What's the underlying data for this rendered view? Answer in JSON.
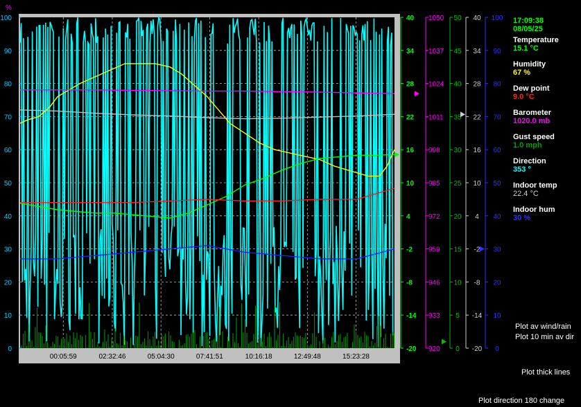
{
  "chart_data": {
    "type": "line",
    "x_ticks": [
      "00:05:59",
      "02:32:46",
      "05:04:30",
      "07:41:51",
      "10:16:18",
      "12:49:48",
      "15:23:28"
    ],
    "left_axis": {
      "label": "%",
      "ylim": [
        0,
        100
      ],
      "ticks": [
        "0",
        "10",
        "20",
        "30",
        "40",
        "50",
        "60",
        "70",
        "80",
        "90",
        "100"
      ]
    },
    "temp_axis": {
      "ylim": [
        -20,
        40
      ],
      "ticks": [
        "-20",
        "-14",
        "-8",
        "-2",
        "4",
        "10",
        "16",
        "22",
        "28",
        "34",
        "40"
      ]
    },
    "pressure_axis": {
      "ylim": [
        920,
        1050
      ],
      "ticks": [
        "920",
        "933",
        "946",
        "959",
        "972",
        "985",
        "998",
        "1011",
        "1024",
        "1037",
        "1050"
      ]
    },
    "wind_axis": {
      "ylim": [
        0,
        50
      ],
      "ticks": [
        "0",
        "5",
        "10",
        "15",
        "20",
        "25",
        "30",
        "35",
        "40",
        "45",
        "50"
      ]
    },
    "indoor_temp_axis": {
      "ylim": [
        -20,
        40
      ],
      "ticks": [
        "-20",
        "-14",
        "-8",
        "-2",
        "4",
        "10",
        "16",
        "22",
        "28",
        "34",
        "40"
      ]
    },
    "indoor_hum_axis": {
      "ylim": [
        0,
        100
      ],
      "ticks": [
        "0",
        "10",
        "20",
        "30",
        "40",
        "50",
        "60",
        "70",
        "80",
        "90",
        "100"
      ]
    },
    "series": [
      {
        "name": "Humidity",
        "color": "#ffff00",
        "x": [
          0,
          0.02,
          0.05,
          0.08,
          0.1,
          0.13,
          0.16,
          0.2,
          0.24,
          0.28,
          0.32,
          0.36,
          0.4,
          0.43,
          0.46,
          0.5,
          0.53,
          0.56,
          0.6,
          0.64,
          0.68,
          0.72,
          0.76,
          0.8,
          0.84,
          0.87,
          0.9,
          0.93,
          0.96,
          0.98,
          1
        ],
        "y": [
          68,
          69,
          70,
          73,
          76,
          78,
          80,
          82,
          84,
          86,
          86,
          86,
          85,
          83,
          80,
          76,
          72,
          68,
          65,
          62,
          60,
          59,
          58,
          57,
          55,
          54,
          53,
          52,
          52,
          55,
          60
        ]
      },
      {
        "name": "Temperature",
        "color": "#00ff00",
        "x": [
          0,
          0.05,
          0.1,
          0.15,
          0.2,
          0.25,
          0.3,
          0.35,
          0.4,
          0.45,
          0.5,
          0.55,
          0.6,
          0.65,
          0.7,
          0.75,
          0.8,
          0.85,
          0.9,
          0.95,
          1
        ],
        "y": [
          6.3,
          5.7,
          5.1,
          4.8,
          4.5,
          4.5,
          4.2,
          3.9,
          3.6,
          4.5,
          6,
          7.5,
          9.6,
          10.8,
          12.3,
          13.5,
          14.4,
          14.7,
          15,
          15,
          15.1
        ]
      },
      {
        "name": "Dew point",
        "color": "#ff2020",
        "x": [
          0,
          0.1,
          0.2,
          0.3,
          0.4,
          0.5,
          0.6,
          0.7,
          0.8,
          0.9,
          1
        ],
        "y": [
          6.4,
          6.4,
          6.4,
          6.4,
          6.7,
          7,
          6.7,
          6.7,
          7,
          7,
          9
        ]
      },
      {
        "name": "Barometer",
        "color": "#ff00ff",
        "x": [
          0,
          0.1,
          0.2,
          0.3,
          0.4,
          0.5,
          0.6,
          0.7,
          0.8,
          0.9,
          1
        ],
        "y": [
          1021.5,
          1021.5,
          1021.5,
          1021.3,
          1021.2,
          1021,
          1021,
          1020.8,
          1020.6,
          1020.3,
          1020
        ]
      },
      {
        "name": "Indoor temp",
        "color": "#c0c0c0",
        "x": [
          0,
          0.1,
          0.2,
          0.3,
          0.4,
          0.5,
          0.6,
          0.7,
          0.8,
          0.9,
          1
        ],
        "y": [
          23.2,
          23,
          22.6,
          22.3,
          22.1,
          21.8,
          21.6,
          21.7,
          21.9,
          22.1,
          22.4
        ]
      },
      {
        "name": "Indoor hum",
        "color": "#2020ff",
        "x": [
          0,
          0.1,
          0.2,
          0.3,
          0.4,
          0.5,
          0.55,
          0.6,
          0.7,
          0.8,
          0.9,
          1
        ],
        "y": [
          27,
          27,
          28,
          29,
          30,
          31,
          30,
          29,
          28,
          27,
          27,
          30
        ]
      }
    ],
    "markers": {
      "temperature": 15.1,
      "barometer": 1020.0,
      "gust": 1.0,
      "indoor_temp": 22.4,
      "indoor_hum": 30
    }
  },
  "readouts": {
    "time": "17:09:38",
    "date": "08/05/25",
    "temperature_label": "Temperature",
    "temperature_value": "15.1 °C",
    "humidity_label": "Humidity",
    "humidity_value": "67 %",
    "dewpoint_label": "Dew point",
    "dewpoint_value": "9.0 °C",
    "barometer_label": "Barometer",
    "barometer_value": "1020.0 mb",
    "gust_label": "Gust speed",
    "gust_value": "1.0 mph",
    "direction_label": "Direction",
    "direction_value": "353 °",
    "indoor_temp_label": "Indoor temp",
    "indoor_temp_value": "22.4 °C",
    "indoor_hum_label": "Indoor hum",
    "indoor_hum_value": "30 %"
  },
  "colors": {
    "temperature": "#00ff00",
    "humidity": "#ffff00",
    "dewpoint": "#ff2020",
    "barometer": "#ff00ff",
    "gust": "#00c000",
    "direction": "#00ffff",
    "indoor_temp": "#c0c0c0",
    "indoor_hum": "#3030ff"
  },
  "options": {
    "plot_av_wind": "Plot av wind/rain",
    "plot_10min": "Plot 10 min av dir",
    "plot_thick": "Plot thick lines",
    "plot_direction": "Plot direction 180 change"
  }
}
